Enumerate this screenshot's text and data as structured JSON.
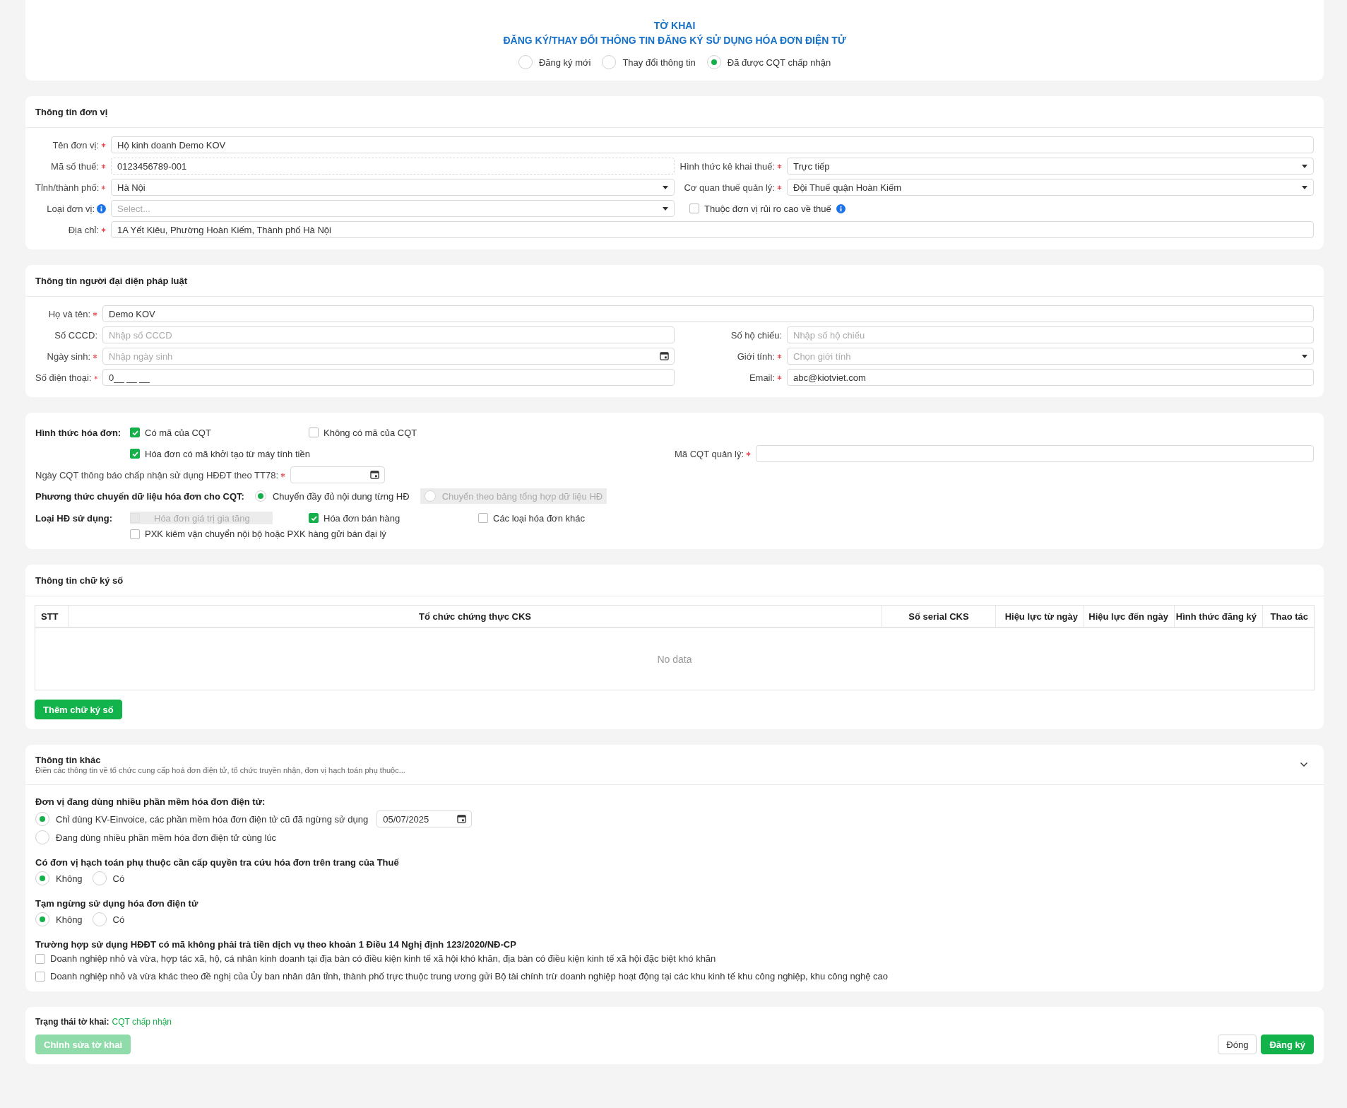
{
  "header": {
    "title": "TỜ KHAI",
    "subtitle": "ĐĂNG KÝ/THAY ĐỔI THÔNG TIN ĐĂNG KÝ SỬ DỤNG HÓA ĐƠN ĐIỆN TỬ",
    "options": [
      {
        "label": "Đăng ký mới",
        "selected": false
      },
      {
        "label": "Thay đổi thông tin",
        "selected": false
      },
      {
        "label": "Đã được CQT chấp nhận",
        "selected": true
      }
    ]
  },
  "unit": {
    "title": "Thông tin đơn vị",
    "rows": [
      [
        {
          "kind": "text",
          "label": "Tên đơn vị:",
          "required": true,
          "value": "Hộ kinh doanh Demo KOV"
        }
      ],
      [
        {
          "kind": "text",
          "label": "Mã số thuế:",
          "required": true,
          "value": "0123456789-001",
          "disabled": true
        },
        {
          "kind": "select",
          "label": "Hình thức kê khai thuế:",
          "required": true,
          "value": "Trực tiếp"
        }
      ],
      [
        {
          "kind": "select",
          "label": "Tỉnh/thành phố:",
          "required": true,
          "value": "Hà Nội"
        },
        {
          "kind": "select",
          "label": "Cơ quan thuế quản lý:",
          "required": true,
          "value": "Đội Thuế quận Hoàn Kiếm"
        }
      ],
      [
        {
          "kind": "select",
          "label": "Loại đơn vị:",
          "info": true,
          "placeholder": "Select..."
        },
        {
          "kind": "checkbox",
          "label": "Thuộc đơn vị rủi ro cao về thuế",
          "checked": false,
          "info": true
        }
      ],
      [
        {
          "kind": "text",
          "label": "Địa chỉ:",
          "required": true,
          "value": "1A Yết Kiêu, Phường Hoàn Kiếm, Thành phố Hà Nội"
        }
      ]
    ]
  },
  "representative": {
    "title": "Thông tin người đại diện pháp luật",
    "rows": [
      [
        {
          "kind": "text",
          "label": "Họ và tên:",
          "required": true,
          "value": "Demo KOV"
        }
      ],
      [
        {
          "kind": "text",
          "label": "Số CCCD:",
          "placeholder": "Nhập số CCCD"
        },
        {
          "kind": "text",
          "label": "Số hộ chiếu:",
          "placeholder": "Nhập số hộ chiếu"
        }
      ],
      [
        {
          "kind": "date",
          "label": "Ngày sinh:",
          "required": true,
          "placeholder": "Nhập ngày sinh"
        },
        {
          "kind": "select",
          "label": "Giới tính:",
          "required": true,
          "placeholder": "Chọn giới tính"
        }
      ],
      [
        {
          "kind": "text",
          "label": "Số điện thoại:",
          "required": true,
          "value": "0__ __ __"
        },
        {
          "kind": "text",
          "label": "Email:",
          "required": true,
          "value": "abc@kiotviet.com"
        }
      ]
    ]
  },
  "invoice": {
    "form_label": "Hình thức hóa đơn:",
    "form_options": [
      {
        "label": "Có mã của CQT",
        "checked": true
      },
      {
        "label": "Không có mã của CQT",
        "checked": false
      }
    ],
    "cash_register": {
      "label": "Hóa đơn có mã khởi tạo từ máy tính tiền",
      "checked": true
    },
    "tax_office_code": {
      "label": "Mã CQT quản lý:",
      "required": true
    },
    "accept_date": {
      "label": "Ngày CQT thông báo chấp nhận sử dụng HĐĐT theo TT78:",
      "required": true
    },
    "transfer_label": "Phương thức chuyển dữ liệu hóa đơn cho CQT:",
    "transfer_options": [
      {
        "label": "Chuyển đầy đủ nội dung từng HĐ",
        "selected": true,
        "disabled": false
      },
      {
        "label": "Chuyển theo bảng tổng hợp dữ liệu HĐ",
        "selected": false,
        "disabled": true
      }
    ],
    "types_label": "Loại HĐ sử dụng:",
    "types": [
      {
        "label": "Hóa đơn giá trị gia tăng",
        "checked": false,
        "disabled": true
      },
      {
        "label": "Hóa đơn bán hàng",
        "checked": true,
        "disabled": false
      },
      {
        "label": "Các loại hóa đơn khác",
        "checked": false,
        "disabled": false
      },
      {
        "label": "PXK kiêm vận chuyển nội bộ hoặc PXK hàng gửi bán đại lý",
        "checked": false,
        "disabled": false
      }
    ]
  },
  "signatures": {
    "title": "Thông tin chữ ký số",
    "columns": [
      "STT",
      "Tổ chức chứng thực CKS",
      "Số serial CKS",
      "Hiệu lực từ ngày",
      "Hiệu lực đến ngày",
      "Hình thức đăng ký",
      "Thao tác"
    ],
    "empty_text": "No data",
    "add_button": "Thêm chữ ký số"
  },
  "other": {
    "title": "Thông tin khác",
    "subtitle": "Điền các thông tin về tổ chức cung cấp hoá đơn điện tử, tổ chức truyền nhận, đơn vị hạch toán phụ thuộc...",
    "questions": [
      {
        "kind": "radio-list",
        "title": "Đơn vị đang dùng nhiều phần mềm hóa đơn điện tử:",
        "options": [
          {
            "label": "Chỉ dùng KV-Einvoice, các phần mềm hóa đơn điện tử cũ đã ngừng sử dụng",
            "selected": true,
            "date": "05/07/2025"
          },
          {
            "label": "Đang dùng nhiều phần mềm hóa đơn điện tử cùng lúc",
            "selected": false
          }
        ]
      },
      {
        "kind": "radio-inline",
        "title": "Có đơn vị hạch toán phụ thuộc cần cấp quyền tra cứu hóa đơn trên trang của Thuế",
        "options": [
          {
            "label": "Không",
            "selected": true
          },
          {
            "label": "Có",
            "selected": false
          }
        ]
      },
      {
        "kind": "radio-inline",
        "title": "Tạm ngừng sử dụng hóa đơn điện tử",
        "options": [
          {
            "label": "Không",
            "selected": true
          },
          {
            "label": "Có",
            "selected": false
          }
        ]
      },
      {
        "kind": "checkbox-list",
        "title": "Trường hợp sử dụng HĐĐT có mã không phải trả tiền dịch vụ theo khoản 1 Điều 14 Nghị định 123/2020/NĐ-CP",
        "options": [
          {
            "label": "Doanh nghiệp nhỏ và vừa, hợp tác xã, hộ, cá nhân kinh doanh tại địa bàn có điều kiện kinh tế xã hội khó khăn, địa bàn có điều kiện kinh tế xã hội đặc biệt khó khăn",
            "checked": false
          },
          {
            "label": "Doanh nghiệp nhỏ và vừa khác theo đề nghị của Ủy ban nhân dân tỉnh, thành phố trực thuộc trung ương gửi Bộ tài chính trừ doanh nghiệp hoạt động tại các khu kinh tế khu công nghiệp, khu công nghệ cao",
            "checked": false
          }
        ]
      }
    ]
  },
  "footer": {
    "status_label": "Trạng thái tờ khai:",
    "status_value": "CQT chấp nhận",
    "edit_button": {
      "label": "Chỉnh sửa tờ khai",
      "disabled": true
    },
    "buttons": [
      {
        "label": "Đóng",
        "kind": "secondary"
      },
      {
        "label": "Đăng ký",
        "kind": "primary"
      }
    ]
  }
}
